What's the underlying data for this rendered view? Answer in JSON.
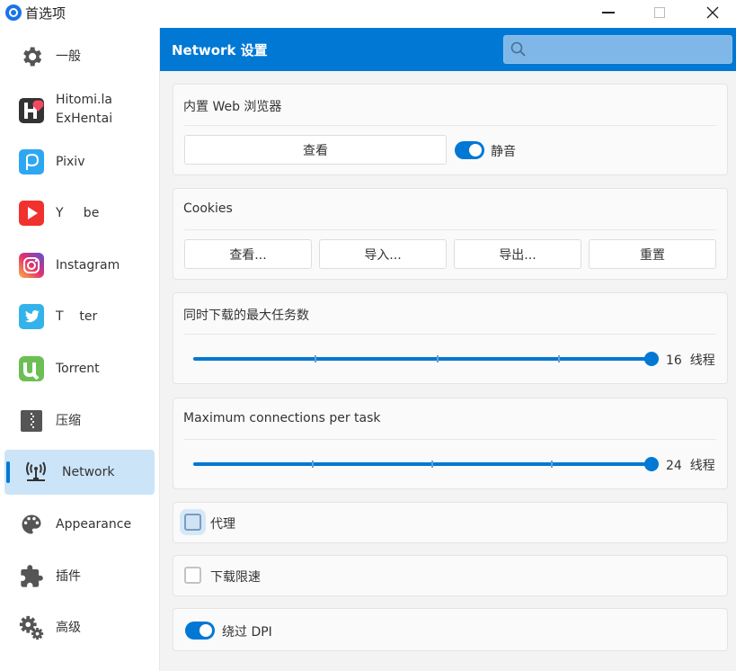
{
  "window": {
    "title": "首选项",
    "controls": {
      "minimize": "minimize",
      "maximize": "maximize",
      "close": "×"
    }
  },
  "sidebar": {
    "items": [
      {
        "label": "一般",
        "icon": "gear-icon",
        "active": false
      },
      {
        "label": "Hitomi.la\nExHentai",
        "label_line1": "Hitomi.la",
        "label_line2": "ExHentai",
        "icon": "hitomi-icon",
        "active": false
      },
      {
        "label": "Pixiv",
        "icon": "pixiv-icon",
        "active": false
      },
      {
        "label": "Y     be",
        "icon": "youtube-icon",
        "active": false
      },
      {
        "label": "Instagram",
        "icon": "instagram-icon",
        "active": false
      },
      {
        "label": "T    ter",
        "icon": "twitter-icon",
        "active": false
      },
      {
        "label": "Torrent",
        "icon": "utorrent-icon",
        "active": false
      },
      {
        "label": "压缩",
        "icon": "archive-icon",
        "active": false
      },
      {
        "label": "Network",
        "icon": "network-antenna-icon",
        "active": true
      },
      {
        "label": "Appearance",
        "icon": "palette-icon",
        "active": false
      },
      {
        "label": "插件",
        "icon": "puzzle-icon",
        "active": false
      },
      {
        "label": "高级",
        "icon": "gears-icon",
        "active": false
      }
    ]
  },
  "header": {
    "title": "Network 设置",
    "search": {
      "placeholder": "",
      "value": ""
    }
  },
  "sections": {
    "browser": {
      "title": "内置 Web 浏览器",
      "view_button": "查看",
      "mute_toggle": {
        "label": "静音",
        "on": true
      }
    },
    "cookies": {
      "title": "Cookies",
      "buttons": [
        "查看...",
        "导入...",
        "导出...",
        "重置"
      ]
    },
    "max_tasks": {
      "title": "同时下载的最大任务数",
      "value": 16,
      "unit": "线程",
      "value_text": "16  线程",
      "fraction": 1.0
    },
    "max_connections": {
      "title": "Maximum connections per task",
      "value": 24,
      "unit": "线程",
      "value_text": "24  线程",
      "fraction": 1.0
    },
    "proxy": {
      "label": "代理",
      "checked": false
    },
    "speed_limit": {
      "label": "下载限速",
      "checked": false
    },
    "bypass_dpi": {
      "label": "绕过 DPI",
      "on": true
    }
  },
  "colors": {
    "accent": "#0078d4",
    "sidebar_active": "#cce4f7",
    "content_bg": "#f3f3f3"
  }
}
